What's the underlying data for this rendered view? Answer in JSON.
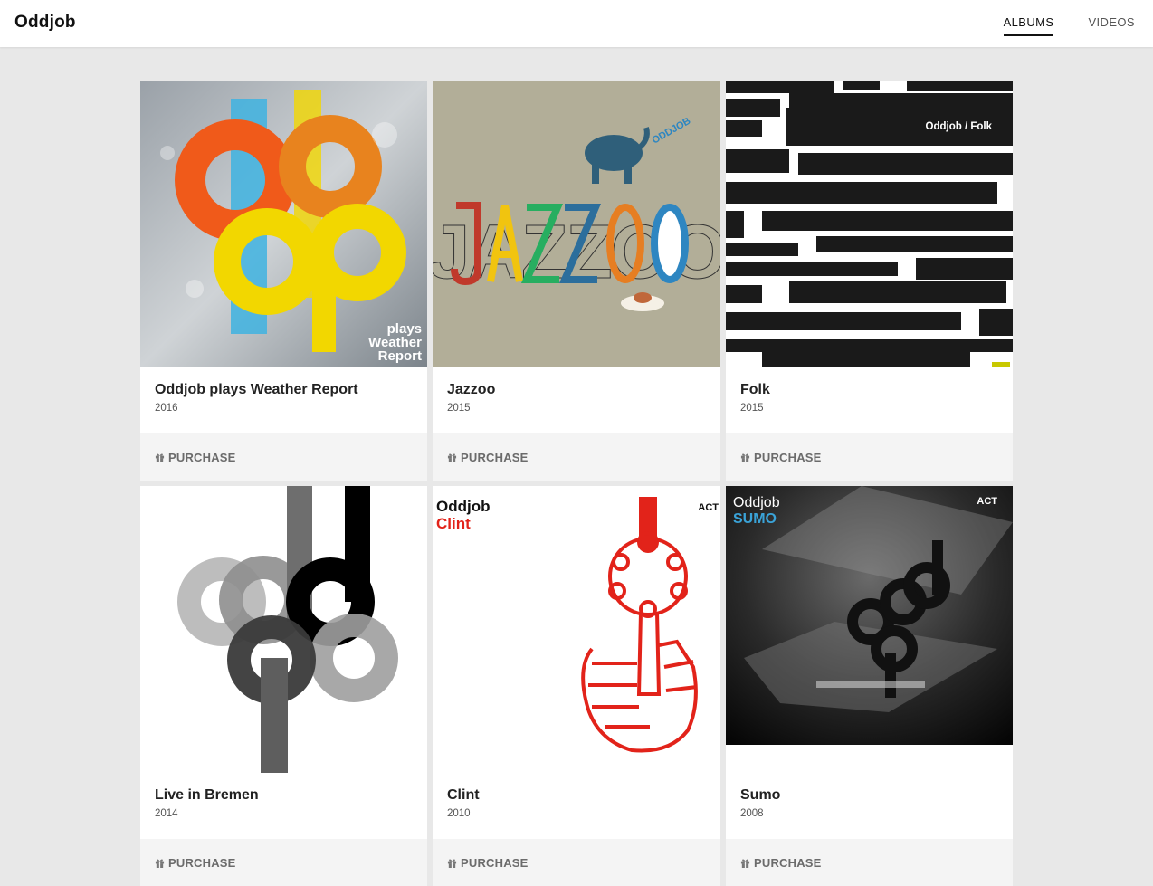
{
  "app": {
    "brand": "Oddjob"
  },
  "nav": {
    "albums": "ALBUMS",
    "videos": "VIDEOS"
  },
  "albums": [
    {
      "title": "Oddjob plays Weather Report",
      "year": "2016",
      "purchase": "PURCHASE",
      "cover_text": [
        "plays",
        "Weather",
        "Report"
      ]
    },
    {
      "title": "Jazzoo",
      "year": "2015",
      "purchase": "PURCHASE",
      "cover_text": [
        "JAZZOO",
        "ODDJOB"
      ]
    },
    {
      "title": "Folk",
      "year": "2015",
      "purchase": "PURCHASE",
      "cover_text": [
        "Oddjob / Folk"
      ]
    },
    {
      "title": "Live in Bremen",
      "year": "2014",
      "purchase": "PURCHASE",
      "cover_text": []
    },
    {
      "title": "Clint",
      "year": "2010",
      "purchase": "PURCHASE",
      "cover_text": [
        "Oddjob",
        "Clint",
        "ACT"
      ]
    },
    {
      "title": "Sumo",
      "year": "2008",
      "purchase": "PURCHASE",
      "cover_text": [
        "Oddjob",
        "SUMO",
        "ACT"
      ]
    }
  ],
  "icons": {
    "purchase": "gift-icon"
  },
  "colors": {
    "accent": "#111111",
    "background": "#e8e8e8",
    "clint_red": "#e2231a",
    "sumo_blue": "#3aa3d8"
  }
}
